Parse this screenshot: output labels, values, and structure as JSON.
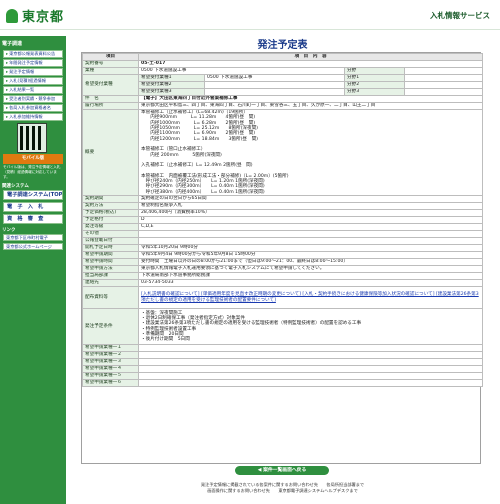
{
  "header": {
    "logo_text": "東京都",
    "site_title": "入札情報サービス"
  },
  "sidebar": {
    "head": "電子調達",
    "items": [
      "東京都公報発表資料公告",
      "年間発注予定情報",
      "発注予定情報",
      "入札(見積)経過情報",
      "入札結果一覧",
      "受注者別実績・競争参加",
      "各局入札参加資格者名",
      "入札参加維持情報"
    ],
    "mobile_label": "モバイル版",
    "mobile_note": "モバイル版は、発注予定情報と入札（見積）経過情報に対応しています。",
    "sub_head": "関連システム",
    "big": [
      "電子調達システム(TOP)",
      "電　子　入　札",
      "資　格　審　査"
    ],
    "links_head": "リンク",
    "links": [
      "東京都下区市町村電子",
      "東京都公式ホームページ"
    ]
  },
  "page_title": "発注予定表",
  "table": {
    "col_item": "項目",
    "col_content": "項　目　内　容",
    "rows": [
      {
        "k": "契約番号",
        "v": "05-土-017"
      },
      {
        "k": "業種",
        "v": "0500 下水道施設工事"
      },
      {
        "k": "発注者",
        "v": "【電子】大田区東海四丁目付近外管渠補修工事"
      },
      {
        "k": "履行場所",
        "v": "東京都大田区平和島三、四丁目、東海四丁目、石川町一丁目、東雪谷三、五丁目、久が原一、二丁目、山王二丁目"
      },
      {
        "k": "契約期間",
        "v": "契約確定の日の翌日から65日間"
      },
      {
        "k": "契約方法",
        "v": "希望制指名競争入札"
      },
      {
        "k": "予定価格(税込)",
        "v": "28,406,400円（消費税率10%）"
      },
      {
        "k": "予定格付",
        "v": "D"
      },
      {
        "k": "発注等級",
        "v": "C,D,E"
      },
      {
        "k": "その他",
        "v": ""
      },
      {
        "k": "公報登載日付",
        "v": ""
      },
      {
        "k": "開札予定日時",
        "v": "令和5年10月20日 9時00分"
      },
      {
        "k": "希望申請期間",
        "v": "令和5年9月4日 9時00分から令和5年9月8日 15時00分"
      },
      {
        "k": "希望申請時間",
        "v": "受付時間　土曜日以外の日の8:00から21:00まで（但日は9:00〜21：00、最終日は8:00〜15:00）"
      },
      {
        "k": "希望申請方法",
        "v": "東京都入札情報電子入札運用要領に基づく電子入札システムにて希望申請してください。"
      },
      {
        "k": "担当局部課",
        "v": "下水道局南部下水道事務所総務課"
      },
      {
        "k": "連絡先",
        "v": "03-5734-5033"
      }
    ],
    "desired_types": [
      {
        "label": "希望受付業種1",
        "code": "0500 下水道施設工事",
        "label2": "分野1"
      },
      {
        "label": "希望受付業種2",
        "code": "",
        "label2": "分野2"
      },
      {
        "label": "希望受付業種3",
        "code": "",
        "label2": "分野3"
      }
    ],
    "division_label": "分野",
    "overview_label": "概要",
    "overview_text": "本管補修工（止水補修工）(L=68.42m)（19箇所）\n　　内径900mm　　　L= 11.28m　　4箇所(昼　間)\n　　内径1000mm　　　L= 6.28m　　2箇所(昼　間)\n　　内径1050mm　　　L= 25.12m　　8箇所(深夜間)\n　　内径1100mm　　　L= 6.90m　　2箇所(昼　間)\n　　内径1200mm　　　L= 18.84m　　3箇所(昼　間)\n\n本管補修工（管口止水補修工）\n　　内径 200mm　　　5箇所(深夜間)\n\n入孔補修工（止水補修工）L= 12.49m 2箇所(昼　間)\n\n本管補修工　内面被覆工法(形成工法・部分補修)（L= 2.00m）(5箇所)\n　呼び径240m（内径250m）　　L= 1.20m 1箇所(深夜間)\n　呼び径290m（内径300m）　　L= 0.40m 1箇所(深夜間)\n　呼び径380m（内径400m）　　L= 0.40m 1箇所(深夜間)",
    "doc_label": "配布資料等",
    "doc_links": "[入札説明書の確認について] [単価適用年度を見直す改正時期の変更について] [入札・契約手続きにおける健康保険等加入状況の確認について] [建設業法第26条第3項ただし書の規定の適用を受ける監理技術者の配置要件について]",
    "conditions_label": "発注予定条件",
    "conditions_text": "・基盤：深夜間施工\n・退休2日制確保工事（発注者指定方式）対象案件\n・建設業法第26条第3項ただし書の規定の適用を受ける監理技術者（特例監理技術者）の配置を認める工事\n・特例監理技術者設置工事\n・準備期間　20日間\n・後片付け期間　5日間",
    "kibo_rows": [
      "希望申請業種一１",
      "希望申請業種一２",
      "希望申請業種一３",
      "希望申請業種一４",
      "希望申請業種一５",
      "希望申請業種一６"
    ]
  },
  "back_button": "◀ 案件一覧画面へ戻る",
  "footer": [
    "発注予定情報に掲載されている各案件に関するお問い合わせ先　　各局所担当部署まで",
    "画面操作に関するお問い合わせ先　　東京都電子調達システムヘルプデスクまで"
  ]
}
